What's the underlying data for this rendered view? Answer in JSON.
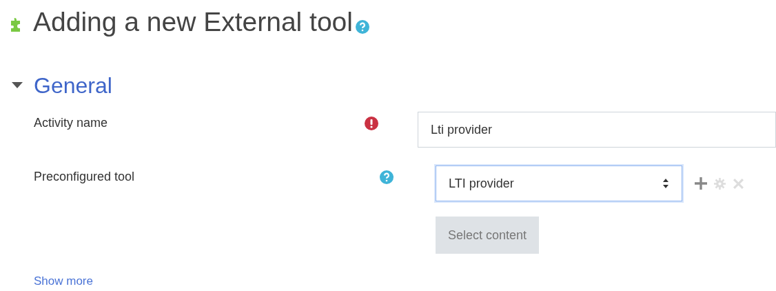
{
  "page_title": "Adding a new External tool",
  "section": {
    "title": "General",
    "expanded": true
  },
  "fields": [
    {
      "label": "Activity name",
      "indicator": {
        "kind": "required"
      },
      "kind": "text",
      "value": "Lti provider",
      "focused": false
    },
    {
      "label": "Preconfigured tool",
      "indicator": {
        "kind": "help"
      },
      "kind": "select",
      "value": "LTI provider",
      "focused": true,
      "actions": [
        {
          "kind": "add",
          "disabled": false
        },
        {
          "kind": "settings",
          "disabled": true
        },
        {
          "kind": "remove",
          "disabled": true
        }
      ]
    }
  ],
  "select_button": {
    "label": "Select content",
    "disabled": true
  },
  "show_more": "Show more"
}
